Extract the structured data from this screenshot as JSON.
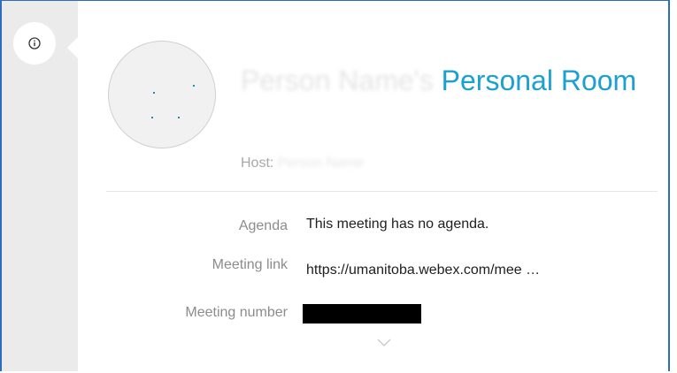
{
  "info_button": {
    "icon": "info-icon"
  },
  "meeting": {
    "title_obscured": "Person Name's",
    "title_visible": "Personal Room",
    "host_label": "Host:",
    "host_obscured": "Person Name"
  },
  "details": [
    {
      "label": "Agenda",
      "value": "This meeting has no agenda."
    },
    {
      "label": "Meeting link",
      "value": "https://umanitoba.webex.com/mee …"
    },
    {
      "label": "Meeting number",
      "value": ""
    }
  ],
  "expand": {
    "icon": "chevron-down-icon"
  },
  "colors": {
    "accent": "#1aa1d2",
    "rail": "#ebebeb",
    "frame_border": "#2e6cc0"
  }
}
